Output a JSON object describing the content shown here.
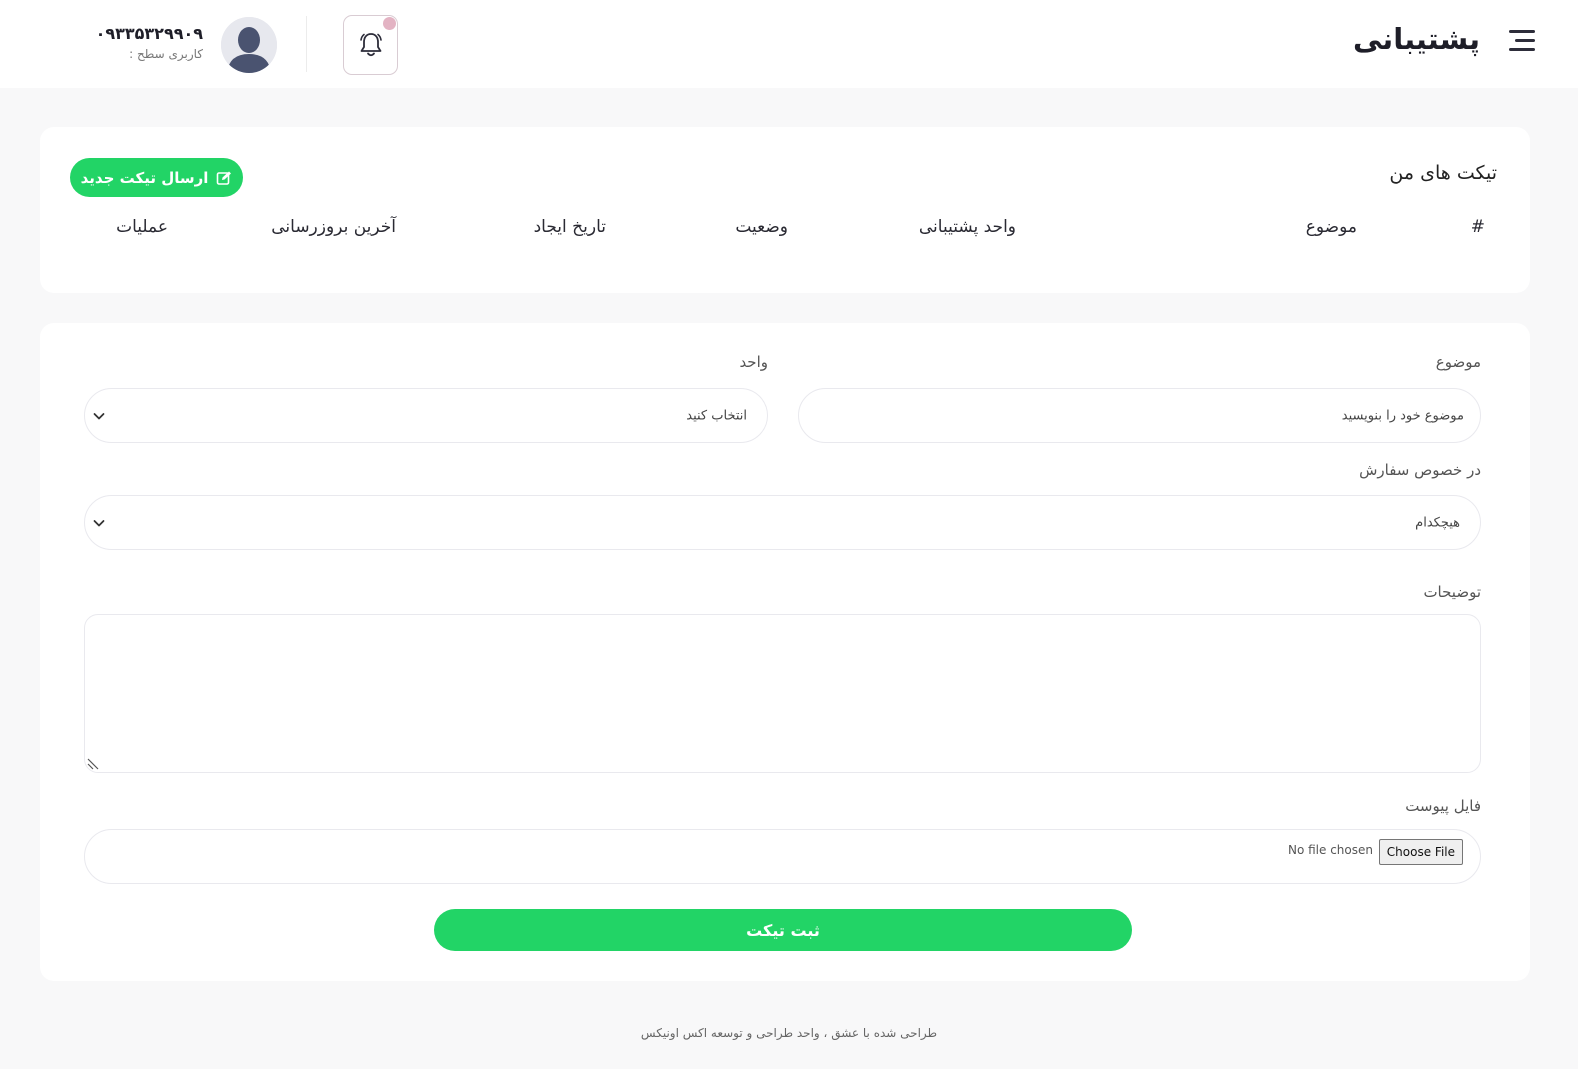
{
  "header": {
    "title": "پشتیبانی",
    "user_phone": "۰۹۳۳۵۳۲۹۹۰۹",
    "user_level_label": "کاربری سطح :"
  },
  "tickets": {
    "title": "تیکت های من",
    "new_ticket_label": "ارسال تیکت جدید",
    "columns": [
      "#",
      "موضوع",
      "واحد پشتیبانی",
      "وضعیت",
      "تاریخ ایجاد",
      "آخرین بروزرسانی",
      "عملیات"
    ]
  },
  "form": {
    "subject_label": "موضوع",
    "subject_placeholder": "موضوع خود را بنویسید",
    "unit_label": "واحد",
    "unit_value": "انتخاب کنید",
    "order_label": "در خصوص سفارش",
    "order_value": "هیچکدام",
    "description_label": "توضیحات",
    "attachment_label": "فایل پیوست",
    "choose_file_label": "Choose File",
    "no_file_label": "No file chosen",
    "submit_label": "ثبت تیکت"
  },
  "footer": {
    "text": "طراحی شده با عشق ، واحد طراحی و توسعه اکس اونیکس"
  },
  "colors": {
    "accent": "#22d466",
    "notification_dot": "#e3b3c3"
  },
  "icons": {
    "menu": "hamburger-menu-icon",
    "notification": "bell-icon",
    "avatar": "user-avatar-icon",
    "new_ticket": "edit-icon",
    "dropdown": "chevron-down-icon"
  }
}
